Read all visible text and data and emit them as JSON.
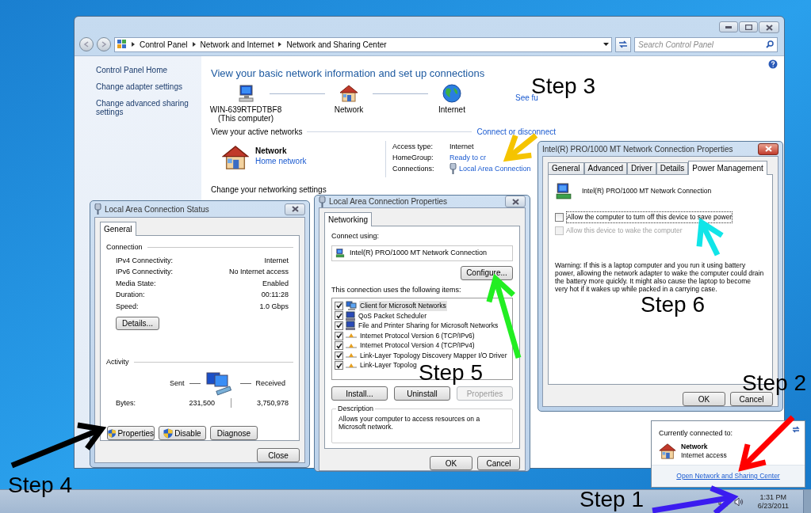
{
  "explorer": {
    "breadcrumb": [
      "Control Panel",
      "Network and Internet",
      "Network and Sharing Center"
    ],
    "search": {
      "placeholder": "Search Control Panel"
    },
    "sidebar": {
      "items": [
        "Control Panel Home",
        "Change adapter settings",
        "Change advanced sharing settings"
      ]
    },
    "heading": "View your basic network information and set up connections",
    "map": [
      {
        "kind": "computer",
        "label": "WIN-639RTFDTBF8",
        "sublabel": "(This computer)"
      },
      {
        "kind": "house",
        "label": "Network"
      },
      {
        "kind": "globe",
        "label": "Internet"
      }
    ],
    "map_link": "See fu",
    "active_title": "View your active networks",
    "active_link": "Connect or disconnect",
    "network": {
      "name": "Network",
      "type": "Home network"
    },
    "details": [
      {
        "kind": "text",
        "label": "Access type:",
        "value": "Internet"
      },
      {
        "kind": "link",
        "label": "HomeGroup:",
        "value": "Ready to cr"
      },
      {
        "kind": "connection",
        "label": "Connections:",
        "value": "Local Area Connection"
      }
    ],
    "settings_title": "Change your networking settings"
  },
  "status_dialog": {
    "title": "Local Area Connection Status",
    "tabs": [
      {
        "label": "General",
        "selected": true
      }
    ],
    "connection_title": "Connection",
    "rows": [
      {
        "label": "IPv4 Connectivity:",
        "value": "Internet"
      },
      {
        "label": "IPv6 Connectivity:",
        "value": "No Internet access"
      },
      {
        "label": "Media State:",
        "value": "Enabled"
      },
      {
        "label": "Duration:",
        "value": "00:11:28"
      },
      {
        "label": "Speed:",
        "value": "1.0 Gbps"
      }
    ],
    "details_button": "Details...",
    "activity_title": "Activity",
    "sent": "Sent",
    "received": "Received",
    "bytes_label": "Bytes:",
    "bytes_sent": "231,500",
    "bytes_received": "3,750,978",
    "buttons": [
      {
        "label": "Properties",
        "shield": true
      },
      {
        "label": "Disable",
        "shield": true
      },
      {
        "label": "Diagnose",
        "shield": false
      }
    ],
    "close": "Close"
  },
  "properties_dialog": {
    "title": "Local Area Connection Properties",
    "tabs": [
      {
        "label": "Networking",
        "selected": true
      }
    ],
    "connect_using": "Connect using:",
    "adapter": "Intel(R) PRO/1000 MT Network Connection",
    "configure": "Configure...",
    "items_title": "This connection uses the following items:",
    "items": [
      {
        "kind": "client",
        "label": "Client for Microsoft Networks",
        "checked": true,
        "selected": true
      },
      {
        "kind": "service",
        "label": "QoS Packet Scheduler",
        "checked": true,
        "selected": false
      },
      {
        "kind": "service",
        "label": "File and Printer Sharing for Microsoft Networks",
        "checked": true,
        "selected": false
      },
      {
        "kind": "protocol",
        "label": "Internet Protocol Version 6 (TCP/IPv6)",
        "checked": true,
        "selected": false
      },
      {
        "kind": "protocol",
        "label": "Internet Protocol Version 4 (TCP/IPv4)",
        "checked": true,
        "selected": false
      },
      {
        "kind": "protocol",
        "label": "Link-Layer Topology Discovery Mapper I/O Driver",
        "checked": true,
        "selected": false
      },
      {
        "kind": "protocol",
        "label": "Link-Layer Topolog",
        "checked": true,
        "selected": false
      }
    ],
    "buttons": [
      {
        "label": "Install...",
        "disabled": false
      },
      {
        "label": "Uninstall",
        "disabled": false
      },
      {
        "label": "Properties",
        "disabled": true
      }
    ],
    "description_title": "Description",
    "description": "Allows your computer to access resources on a Microsoft network.",
    "ok": "OK",
    "cancel": "Cancel"
  },
  "adapter_dialog": {
    "title": "Intel(R) PRO/1000 MT Network Connection Properties",
    "tabs": [
      {
        "label": "General",
        "selected": false
      },
      {
        "label": "Advanced",
        "selected": false
      },
      {
        "label": "Driver",
        "selected": false
      },
      {
        "label": "Details",
        "selected": false
      },
      {
        "label": "Power Management",
        "selected": true
      }
    ],
    "adapter": "Intel(R) PRO/1000 MT Network Connection",
    "options": [
      {
        "label": "Allow the computer to turn off this device to save power",
        "checked": false,
        "disabled": false
      },
      {
        "label": "Allow this device to wake the computer",
        "checked": false,
        "disabled": true
      }
    ],
    "warning": "Warning: If this is a laptop computer and you run it using battery power, allowing the network adapter to wake the computer could drain the battery more quickly. It might also cause the laptop to become very hot if it wakes up while packed in a carrying case.",
    "ok": "OK",
    "cancel": "Cancel"
  },
  "notification": {
    "title": "Currently connected to:",
    "network": "Network",
    "status": "Internet access",
    "link": "Open Network and Sharing Center"
  },
  "taskbar": {
    "time": "1:31 PM",
    "date": "6/23/2011"
  },
  "annotations": [
    {
      "label": "Step 3",
      "color": "#f5c400"
    },
    {
      "label": "Step 4",
      "color": "#000000"
    },
    {
      "label": "Step 5",
      "color": "#22ee22"
    },
    {
      "label": "Step 6",
      "color": "#11e5e8"
    },
    {
      "label": "Step 2",
      "color": "#ff0000"
    },
    {
      "label": "Step 1",
      "color": "#3b1cf0"
    }
  ]
}
